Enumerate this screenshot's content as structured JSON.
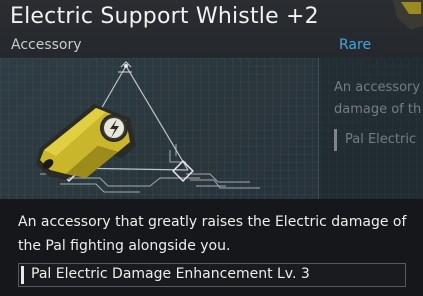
{
  "item": {
    "name": "Electric Support Whistle +2",
    "category": "Accessory",
    "rarity": "Rare",
    "description": "An accessory that greatly raises the Electric damage of the Pal fighting alongside you.",
    "effect": "Pal Electric Damage Enhancement Lv. 3",
    "icon": "electric-whistle-icon"
  },
  "ghost_panel": {
    "line1": "An accessory",
    "line2": "damage of th",
    "effect": "Pal Electric"
  },
  "colors": {
    "rarity": "#3fa6e3",
    "whistle": "#c9b62a",
    "panel_bg": "#2c383f",
    "header_bg": "#2a2d31"
  }
}
